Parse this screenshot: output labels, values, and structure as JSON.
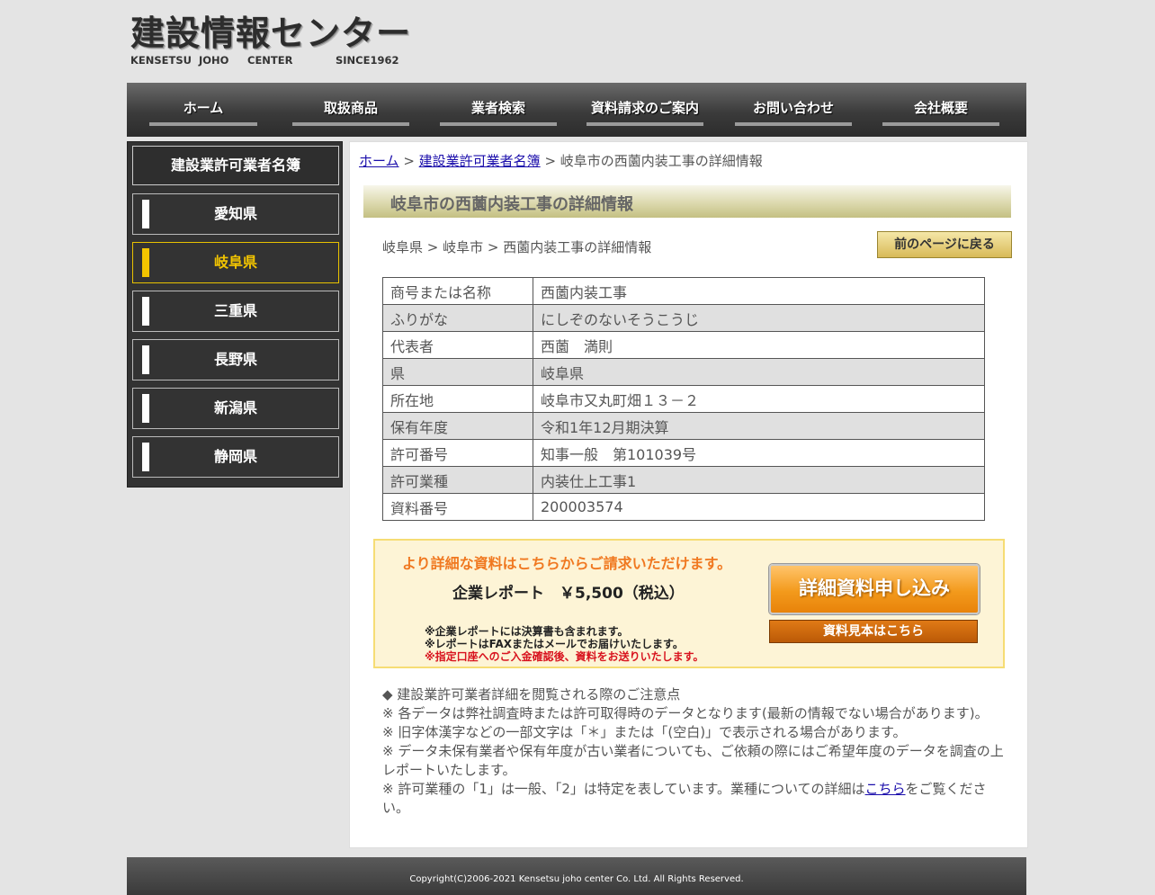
{
  "header": {
    "logo_main": "建設情報センター",
    "logo_sub": [
      "KENSETSU",
      "JOHO",
      "CENTER",
      "SINCE1962"
    ]
  },
  "nav": [
    {
      "label": "ホーム"
    },
    {
      "label": "取扱商品"
    },
    {
      "label": "業者検索"
    },
    {
      "label": "資料請求のご案内"
    },
    {
      "label": "お問い合わせ"
    },
    {
      "label": "会社概要"
    }
  ],
  "sidebar": {
    "heading": "建設業許可業者名簿",
    "items": [
      {
        "label": "愛知県",
        "active": false
      },
      {
        "label": "岐阜県",
        "active": true
      },
      {
        "label": "三重県",
        "active": false
      },
      {
        "label": "長野県",
        "active": false
      },
      {
        "label": "新潟県",
        "active": false
      },
      {
        "label": "静岡県",
        "active": false
      }
    ]
  },
  "breadcrumb": {
    "home": "ホーム",
    "sep1": " > ",
    "list": "建設業許可業者名簿",
    "sep2": " > ",
    "current": "岐阜市の西薗内装工事の詳細情報"
  },
  "page_title": "岐阜市の西薗内装工事の詳細情報",
  "sub_breadcrumb": "岐阜県 > 岐阜市 > 西薗内装工事の詳細情報",
  "back_button": "前のページに戻る",
  "details": [
    {
      "key": "商号または名称",
      "value": "西薗内装工事"
    },
    {
      "key": "ふりがな",
      "value": "にしぞのないそうこうじ"
    },
    {
      "key": "代表者",
      "value": "西薗　満則"
    },
    {
      "key": "県",
      "value": "岐阜県"
    },
    {
      "key": "所在地",
      "value": "岐阜市又丸町畑１３－２"
    },
    {
      "key": "保有年度",
      "value": "令和1年12月期決算"
    },
    {
      "key": "許可番号",
      "value": "知事一般　第101039号"
    },
    {
      "key": "許可業種",
      "value": "内装仕上工事1"
    },
    {
      "key": "資料番号",
      "value": "200003574"
    }
  ],
  "promo": {
    "headline": "より詳細な資料はこちらからご請求いただけます。",
    "product": "企業レポート　￥5,500（税込）",
    "notes": [
      "※企業レポートには決算書も含まれます。",
      "※レポートはFAXまたはメールでお届けいたします。",
      "※指定口座へのご入金確認後、資料をお送りいたします。"
    ],
    "apply_button": "詳細資料申し込み",
    "sample_button": "資料見本はこちら"
  },
  "notes": {
    "heading": "◆ 建設業許可業者詳細を閲覧される際のご注意点",
    "line1": "※ 各データは弊社調査時または許可取得時のデータとなります(最新の情報でない場合があります)。",
    "line2": "※ 旧字体漢字などの一部文字は「＊」または「(空白)」で表示される場合があります。",
    "line3": "※ データ未保有業者や保有年度が古い業者についても、ご依頼の際にはご希望年度のデータを調査の上レポートいたします。",
    "line4_pre": "※ 許可業種の「1」は一般、「2」は特定を表しています。業種についての詳細は",
    "line4_link": "こちら",
    "line4_post": "をご覧ください。"
  },
  "footer": {
    "copyright": "Copyright(C)2006-2021 Kensetsu joho center Co. Ltd. All Rights Reserved."
  }
}
